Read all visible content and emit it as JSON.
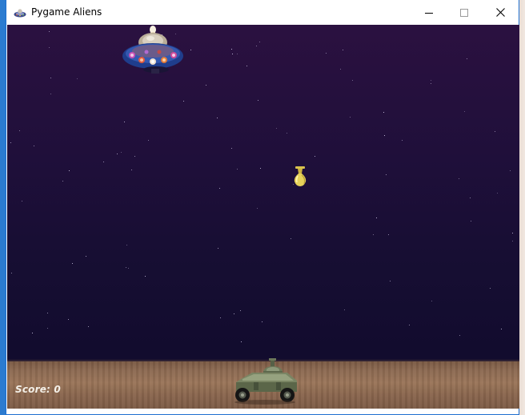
{
  "window": {
    "title": "Pygame Aliens",
    "app_icon": "pygame-alien-ship-icon",
    "controls": {
      "minimize_icon": "minimize-icon",
      "maximize_icon": "maximize-icon",
      "close_icon": "close-icon"
    }
  },
  "game": {
    "score_text": "Score: 0",
    "sprites": {
      "enemy": "alien-ufo",
      "projectile": "alien-bomb",
      "player": "player-tank"
    },
    "colors": {
      "sky_top": "#2b1140",
      "sky_bottom": "#120c2c",
      "ground": "#9a7559",
      "score_text": "#f4f0e8"
    }
  }
}
